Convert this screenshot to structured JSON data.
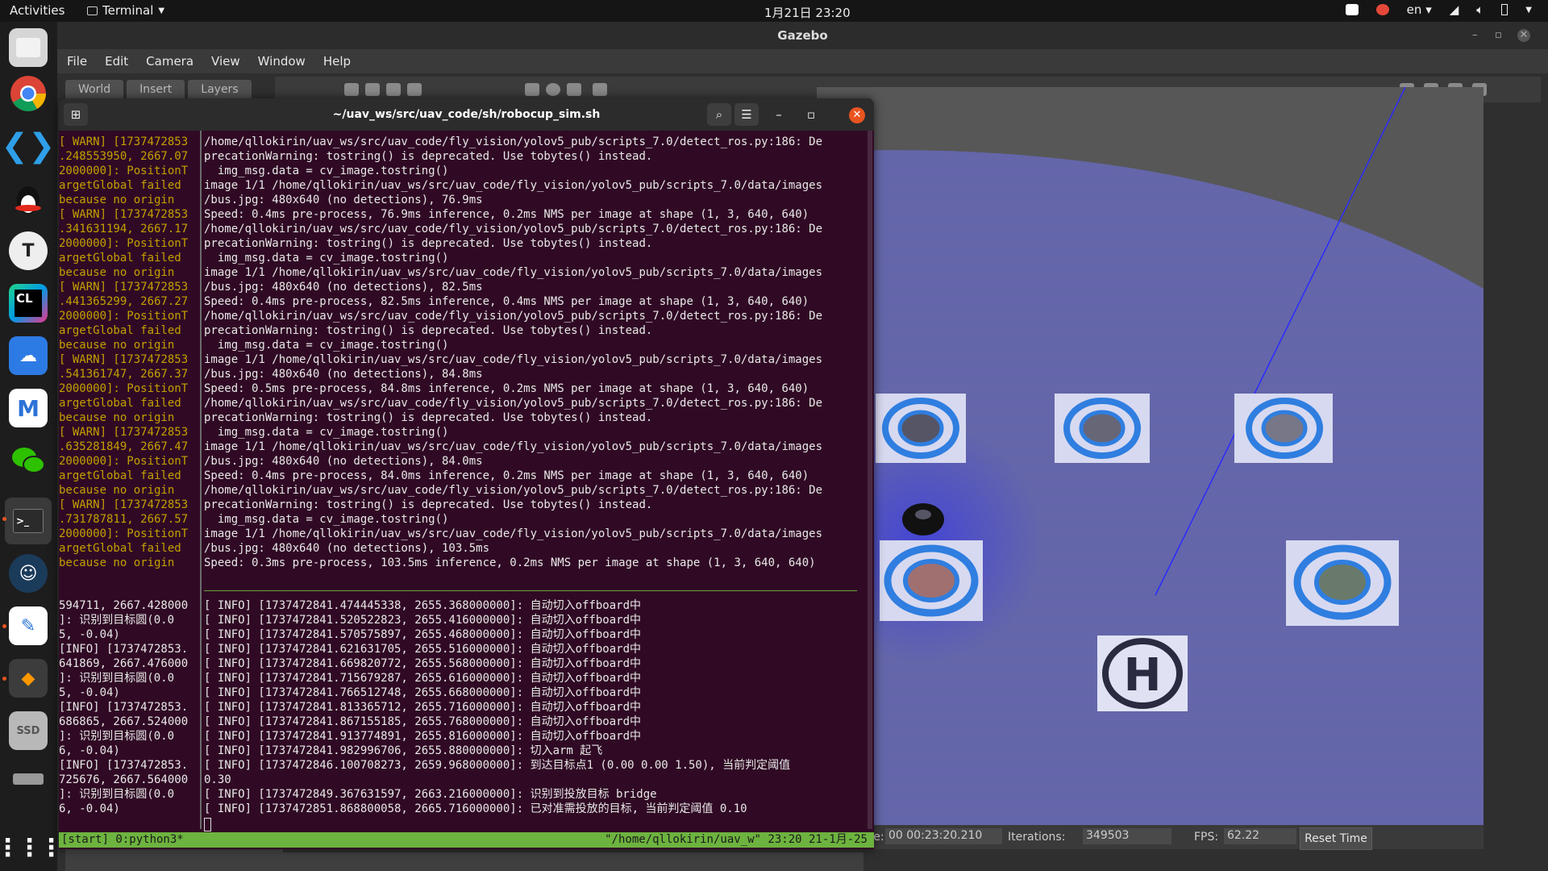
{
  "topbar": {
    "activities": "Activities",
    "app": "Terminal",
    "clock": "1月21日  23:20",
    "lang": "en"
  },
  "dock": {
    "apps": [
      "files-icon",
      "chrome-icon",
      "vscode-icon",
      "qq-icon",
      "typora-icon",
      "clion-icon",
      "baidu-netdisk-icon",
      "gmail-icon",
      "wechat-icon",
      "terminal-icon",
      "cloud-icon",
      "text-editor-icon",
      "sublime-icon",
      "ssd-icon",
      "drive-icon",
      "show-apps-icon"
    ]
  },
  "gazebo": {
    "title": "Gazebo",
    "menu": [
      "File",
      "Edit",
      "Camera",
      "View",
      "Window",
      "Help"
    ],
    "tabs": [
      "World",
      "Insert",
      "Layers"
    ],
    "status": {
      "real_time_label": "Real Time:",
      "real_time": "00 00:23:20.210",
      "iterations_label": "Iterations:",
      "iterations": "349503",
      "fps_label": "FPS:",
      "fps": "62.22",
      "reset": "Reset Time"
    }
  },
  "terminal": {
    "title": "~/uav_ws/src/uav_code/sh/robocup_sim.sh",
    "left_top": [
      "[ WARN] [1737472853",
      ".248553950, 2667.07",
      "2000000]: PositionT",
      "argetGlobal failed",
      "because no origin",
      "[ WARN] [1737472853",
      ".341631194, 2667.17",
      "2000000]: PositionT",
      "argetGlobal failed",
      "because no origin",
      "[ WARN] [1737472853",
      ".441365299, 2667.27",
      "2000000]: PositionT",
      "argetGlobal failed",
      "because no origin",
      "[ WARN] [1737472853",
      ".541361747, 2667.37",
      "2000000]: PositionT",
      "argetGlobal failed",
      "because no origin",
      "[ WARN] [1737472853",
      ".635281849, 2667.47",
      "2000000]: PositionT",
      "argetGlobal failed",
      "because no origin",
      "[ WARN] [1737472853",
      ".731787811, 2667.57",
      "2000000]: PositionT",
      "argetGlobal failed",
      "because no origin"
    ],
    "right_top": [
      "/home/qllokirin/uav_ws/src/uav_code/fly_vision/yolov5_pub/scripts_7.0/detect_ros.py:186: De",
      "precationWarning: tostring() is deprecated. Use tobytes() instead.",
      "  img_msg.data = cv_image.tostring()",
      "image 1/1 /home/qllokirin/uav_ws/src/uav_code/fly_vision/yolov5_pub/scripts_7.0/data/images",
      "/bus.jpg: 480x640 (no detections), 76.9ms",
      "Speed: 0.4ms pre-process, 76.9ms inference, 0.2ms NMS per image at shape (1, 3, 640, 640)",
      "/home/qllokirin/uav_ws/src/uav_code/fly_vision/yolov5_pub/scripts_7.0/detect_ros.py:186: De",
      "precationWarning: tostring() is deprecated. Use tobytes() instead.",
      "  img_msg.data = cv_image.tostring()",
      "image 1/1 /home/qllokirin/uav_ws/src/uav_code/fly_vision/yolov5_pub/scripts_7.0/data/images",
      "/bus.jpg: 480x640 (no detections), 82.5ms",
      "Speed: 0.4ms pre-process, 82.5ms inference, 0.4ms NMS per image at shape (1, 3, 640, 640)",
      "/home/qllokirin/uav_ws/src/uav_code/fly_vision/yolov5_pub/scripts_7.0/detect_ros.py:186: De",
      "precationWarning: tostring() is deprecated. Use tobytes() instead.",
      "  img_msg.data = cv_image.tostring()",
      "image 1/1 /home/qllokirin/uav_ws/src/uav_code/fly_vision/yolov5_pub/scripts_7.0/data/images",
      "/bus.jpg: 480x640 (no detections), 84.8ms",
      "Speed: 0.5ms pre-process, 84.8ms inference, 0.2ms NMS per image at shape (1, 3, 640, 640)",
      "/home/qllokirin/uav_ws/src/uav_code/fly_vision/yolov5_pub/scripts_7.0/detect_ros.py:186: De",
      "precationWarning: tostring() is deprecated. Use tobytes() instead.",
      "  img_msg.data = cv_image.tostring()",
      "image 1/1 /home/qllokirin/uav_ws/src/uav_code/fly_vision/yolov5_pub/scripts_7.0/data/images",
      "/bus.jpg: 480x640 (no detections), 84.0ms",
      "Speed: 0.4ms pre-process, 84.0ms inference, 0.2ms NMS per image at shape (1, 3, 640, 640)",
      "/home/qllokirin/uav_ws/src/uav_code/fly_vision/yolov5_pub/scripts_7.0/detect_ros.py:186: De",
      "precationWarning: tostring() is deprecated. Use tobytes() instead.",
      "  img_msg.data = cv_image.tostring()",
      "image 1/1 /home/qllokirin/uav_ws/src/uav_code/fly_vision/yolov5_pub/scripts_7.0/data/images",
      "/bus.jpg: 480x640 (no detections), 103.5ms",
      "Speed: 0.3ms pre-process, 103.5ms inference, 0.2ms NMS per image at shape (1, 3, 640, 640)"
    ],
    "left_bottom": [
      "594711, 2667.428000",
      "]: 识别到目标圆(0.0",
      "5, -0.04)",
      "[INFO] [1737472853.",
      "641869, 2667.476000",
      "]: 识别到目标圆(0.0",
      "5, -0.04)",
      "[INFO] [1737472853.",
      "686865, 2667.524000",
      "]: 识别到目标圆(0.0",
      "6, -0.04)",
      "[INFO] [1737472853.",
      "725676, 2667.564000",
      "]: 识别到目标圆(0.0",
      "6, -0.04)"
    ],
    "right_bottom": [
      "[ INFO] [1737472841.474445338, 2655.368000000]: 自动切入offboard中",
      "[ INFO] [1737472841.520522823, 2655.416000000]: 自动切入offboard中",
      "[ INFO] [1737472841.570575897, 2655.468000000]: 自动切入offboard中",
      "[ INFO] [1737472841.621631705, 2655.516000000]: 自动切入offboard中",
      "[ INFO] [1737472841.669820772, 2655.568000000]: 自动切入offboard中",
      "[ INFO] [1737472841.715679287, 2655.616000000]: 自动切入offboard中",
      "[ INFO] [1737472841.766512748, 2655.668000000]: 自动切入offboard中",
      "[ INFO] [1737472841.813365712, 2655.716000000]: 自动切入offboard中",
      "[ INFO] [1737472841.867155185, 2655.768000000]: 自动切入offboard中",
      "[ INFO] [1737472841.913774891, 2655.816000000]: 自动切入offboard中",
      "[ INFO] [1737472841.982996706, 2655.880000000]: 切入arm 起飞",
      "[ INFO] [1737472846.100708273, 2659.968000000]: 到达目标点1 (0.00 0.00 1.50), 当前判定阈值",
      "0.30",
      "[ INFO] [1737472849.367631597, 2663.216000000]: 识别到投放目标 bridge",
      "[ INFO] [1737472851.868800058, 2665.716000000]: 已对准需投放的目标, 当前判定阈值 0.10"
    ],
    "status_left": "[start] 0:python3*",
    "status_right": "\"/home/qllokirin/uav_w\" 23:20 21-1月-25"
  }
}
